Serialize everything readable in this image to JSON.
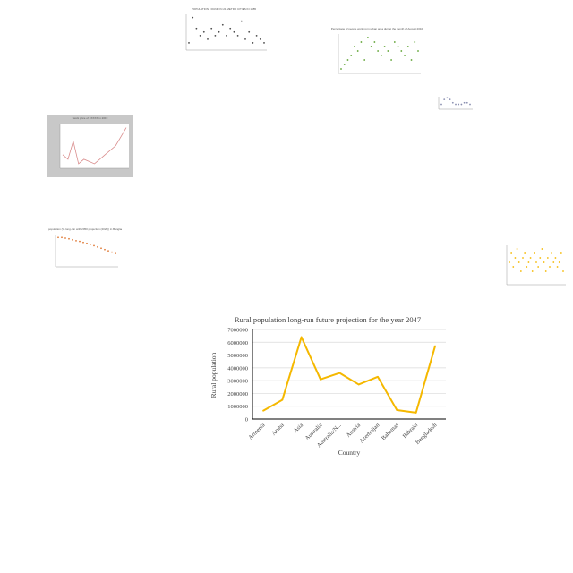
{
  "accent": "#f5b800",
  "thumbnails": [
    {
      "id": "thumb-scatter-top",
      "title": "POPULATION FOUND IN 21 METRO CITIES IN 1985",
      "kind": "scatter",
      "color": "#4b4b4b",
      "values": [
        2,
        9,
        6,
        4,
        5,
        3,
        6,
        4,
        5,
        7,
        4,
        6,
        5,
        4,
        8,
        3,
        5,
        2,
        4,
        3,
        2
      ]
    },
    {
      "id": "thumb-scatter-green",
      "title": "Percentage of people working in urban area during the month of August 2010",
      "kind": "scatter",
      "color": "#5aa02c",
      "values": [
        1,
        2,
        3,
        4,
        6,
        5,
        7,
        3,
        8,
        6,
        7,
        5,
        4,
        6,
        5,
        3,
        7,
        6,
        5,
        4,
        6,
        3,
        7,
        5
      ]
    },
    {
      "id": "thumb-scatter-small-right",
      "title": "",
      "kind": "scatter",
      "color": "#8a8fb0",
      "values": [
        3,
        6,
        7,
        6,
        4,
        3,
        3,
        3,
        4,
        4,
        3
      ]
    },
    {
      "id": "thumb-line-gray",
      "title": "Stock price of XXXXX in 2019",
      "kind": "line",
      "color": "#d98c8c",
      "values": [
        3,
        2,
        6,
        1,
        2,
        1.5,
        1,
        2,
        3,
        4,
        5,
        7,
        9
      ]
    },
    {
      "id": "thumb-decline",
      "title": "Rural population (% long-run with 2050 projection (2020)) in Bangladesh",
      "kind": "scatter",
      "color": "#e07b39",
      "values": [
        9,
        9,
        8.8,
        8.6,
        8.3,
        8,
        7.8,
        7.5,
        7.2,
        6.9,
        6.5,
        6.1,
        5.7,
        5.3,
        4.9,
        4.5,
        4.1
      ]
    },
    {
      "id": "thumb-scatter-right",
      "title": "",
      "kind": "scatter",
      "color": "#f5b800",
      "values": [
        5,
        7,
        4,
        6,
        8,
        5,
        3,
        6,
        7,
        4,
        5,
        6,
        3,
        7,
        5,
        4,
        6,
        8,
        5,
        3,
        6,
        4,
        7,
        5,
        6,
        4,
        5,
        7,
        3
      ]
    }
  ],
  "chart_data": {
    "type": "line",
    "title": "Rural population long-run future projection for the year 2047",
    "xlabel": "Country",
    "ylabel": "Rural population",
    "categories": [
      "Armenia",
      "Aruba",
      "Asia",
      "Australia",
      "Australia/N...",
      "Austria",
      "Azerbaijan",
      "Bahamas",
      "Bahrain",
      "Bangladesh"
    ],
    "series": [
      {
        "values": [
          650000,
          1500000,
          6400000,
          3100000,
          3600000,
          2700000,
          3300000,
          700000,
          500000,
          5700000
        ]
      }
    ],
    "ylim": [
      0,
      7000000
    ],
    "yticks": [
      "0",
      "1000000",
      "2000000",
      "3000000",
      "4000000",
      "5000000",
      "6000000",
      "7000000"
    ],
    "grid": true,
    "line_color": "#f5b800"
  }
}
